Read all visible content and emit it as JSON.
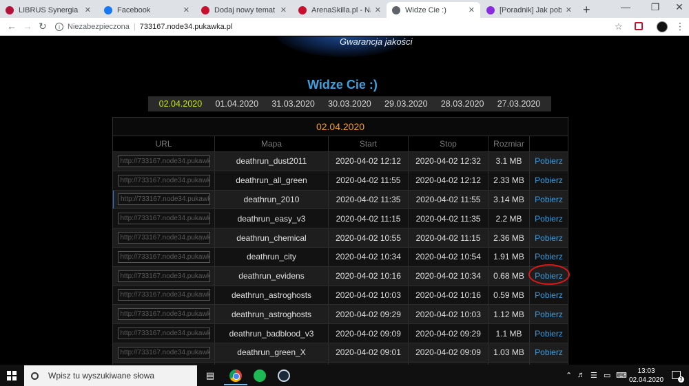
{
  "browser": {
    "tabs": [
      {
        "title": "LIBRUS Synergia",
        "favicon_color": "#b5123a"
      },
      {
        "title": "Facebook",
        "favicon_color": "#1877f2"
      },
      {
        "title": "Dodaj nowy temat - Arc",
        "favicon_color": "#c8102e"
      },
      {
        "title": "ArenaSkilla.pl - Najleps",
        "favicon_color": "#c8102e"
      },
      {
        "title": "Widze Cie :)",
        "favicon_color": "#5f6368"
      },
      {
        "title": "[Poradnik] Jak pobrać i",
        "favicon_color": "#8a2be2"
      }
    ],
    "active_tab": 4,
    "security_label": "Niezabezpieczona",
    "url": "733167.node34.pukawka.pl"
  },
  "page": {
    "tagline": "Gwarancja jakości",
    "title": "Widze Cie :)",
    "dates": [
      "02.04.2020",
      "01.04.2020",
      "31.03.2020",
      "30.03.2020",
      "29.03.2020",
      "28.03.2020",
      "27.03.2020"
    ],
    "selected_date": "02.04.2020",
    "table_title": "02.04.2020",
    "columns": [
      "URL",
      "Mapa",
      "Start",
      "Stop",
      "Rozmiar",
      ""
    ],
    "rows": [
      {
        "url": "http://733167.node34.pukawk",
        "map": "deathrun_dust2011",
        "start": "2020-04-02 12:12",
        "stop": "2020-04-02 12:32",
        "size": "3.1 MB",
        "action": "Pobierz"
      },
      {
        "url": "http://733167.node34.pukawk",
        "map": "deathrun_all_green",
        "start": "2020-04-02 11:55",
        "stop": "2020-04-02 12:12",
        "size": "2.33 MB",
        "action": "Pobierz"
      },
      {
        "url": "http://733167.node34.pukawk",
        "map": "deathrun_2010",
        "start": "2020-04-02 11:35",
        "stop": "2020-04-02 11:55",
        "size": "3.14 MB",
        "action": "Pobierz"
      },
      {
        "url": "http://733167.node34.pukawk",
        "map": "deathrun_easy_v3",
        "start": "2020-04-02 11:15",
        "stop": "2020-04-02 11:35",
        "size": "2.2 MB",
        "action": "Pobierz"
      },
      {
        "url": "http://733167.node34.pukawk",
        "map": "deathrun_chemical",
        "start": "2020-04-02 10:55",
        "stop": "2020-04-02 11:15",
        "size": "2.36 MB",
        "action": "Pobierz"
      },
      {
        "url": "http://733167.node34.pukawk",
        "map": "deathrun_city",
        "start": "2020-04-02 10:34",
        "stop": "2020-04-02 10:54",
        "size": "1.91 MB",
        "action": "Pobierz"
      },
      {
        "url": "http://733167.node34.pukawk",
        "map": "deathrun_evidens",
        "start": "2020-04-02 10:16",
        "stop": "2020-04-02 10:34",
        "size": "0.68 MB",
        "action": "Pobierz"
      },
      {
        "url": "http://733167.node34.pukawk",
        "map": "deathrun_astroghosts",
        "start": "2020-04-02 10:03",
        "stop": "2020-04-02 10:16",
        "size": "0.59 MB",
        "action": "Pobierz"
      },
      {
        "url": "http://733167.node34.pukawk",
        "map": "deathrun_astroghosts",
        "start": "2020-04-02 09:29",
        "stop": "2020-04-02 10:03",
        "size": "1.12 MB",
        "action": "Pobierz"
      },
      {
        "url": "http://733167.node34.pukawk",
        "map": "deathrun_badblood_v3",
        "start": "2020-04-02 09:09",
        "stop": "2020-04-02 09:29",
        "size": "1.1 MB",
        "action": "Pobierz"
      },
      {
        "url": "http://733167.node34.pukawk",
        "map": "deathrun_green_X",
        "start": "2020-04-02 09:01",
        "stop": "2020-04-02 09:09",
        "size": "1.03 MB",
        "action": "Pobierz"
      },
      {
        "url": "http://733167.node34.pukawk",
        "map": "",
        "start": "",
        "stop": "",
        "size": "",
        "action": ""
      }
    ]
  },
  "taskbar": {
    "search_placeholder": "Wpisz tu wyszukiwane słowa",
    "time": "13:03",
    "date": "02.04.2020",
    "notification_count": "3"
  }
}
